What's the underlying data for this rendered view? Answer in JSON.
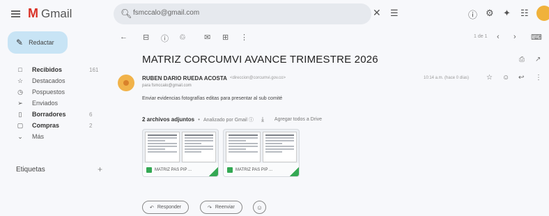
{
  "app": {
    "logo_letter": "M",
    "name": "Gmail",
    "brand_color": "#d93025"
  },
  "search": {
    "value": "fsmccalo@gmail.com",
    "icon": "search-icon",
    "clear_icon": "close-icon",
    "options_icon": "tune-icon"
  },
  "top_icons": [
    "help-icon",
    "settings-icon",
    "gemini-icon",
    "apps-icon",
    "account-avatar"
  ],
  "compose": {
    "label": "Redactar",
    "icon": "pencil-icon"
  },
  "sidebar": {
    "items": [
      {
        "label": "Recibidos",
        "count": "161",
        "icon": "inbox-icon",
        "bold": true
      },
      {
        "label": "Destacados",
        "count": "",
        "icon": "star-icon",
        "bold": false
      },
      {
        "label": "Pospuestos",
        "count": "",
        "icon": "clock-icon",
        "bold": false
      },
      {
        "label": "Enviados",
        "count": "",
        "icon": "send-icon",
        "bold": false
      },
      {
        "label": "Borradores",
        "count": "6",
        "icon": "draft-icon",
        "bold": true
      },
      {
        "label": "Compras",
        "count": "2",
        "icon": "shopping-icon",
        "bold": true
      },
      {
        "label": "Más",
        "count": "",
        "icon": "chevron-down-icon",
        "bold": false
      }
    ],
    "labels_title": "Etiquetas",
    "labels_add": "+"
  },
  "toolbar": {
    "icons": [
      "back-arrow-icon",
      "archive-icon",
      "report-spam-icon",
      "delete-icon",
      "mark-unread-icon",
      "move-to-icon",
      "more-vert-icon"
    ],
    "pager": "1 de 1"
  },
  "message": {
    "subject": "MATRIZ CORCUMVI AVANCE TRIMESTRE 2026",
    "sender_name": "RUBEN DARIO RUEDA ACOSTA",
    "sender_email": "<direccion@corcumvi.gov.co>",
    "recipient": "para fsmccalo@gmail.com",
    "date": "10:14 a.m. (hace 0 días)",
    "body": "Enviar evidencias   fotografías editas para presentar al sub comité",
    "action_icons": [
      "star-icon",
      "emoji-icon",
      "reply-icon",
      "more-vert-icon"
    ]
  },
  "attachments": {
    "count_label": "2 archivos adjuntos",
    "scan_label": "Analizado por Gmail ⓘ",
    "download_icon": "download-icon",
    "drive_label": "Agregar todos a Drive",
    "files": [
      {
        "name": "MATRIZ PAS PIP ..."
      },
      {
        "name": "MATRIZ PAS PIP ..."
      }
    ]
  },
  "reply_bar": {
    "reply_label": "Responder",
    "forward_label": "Reenviar"
  }
}
